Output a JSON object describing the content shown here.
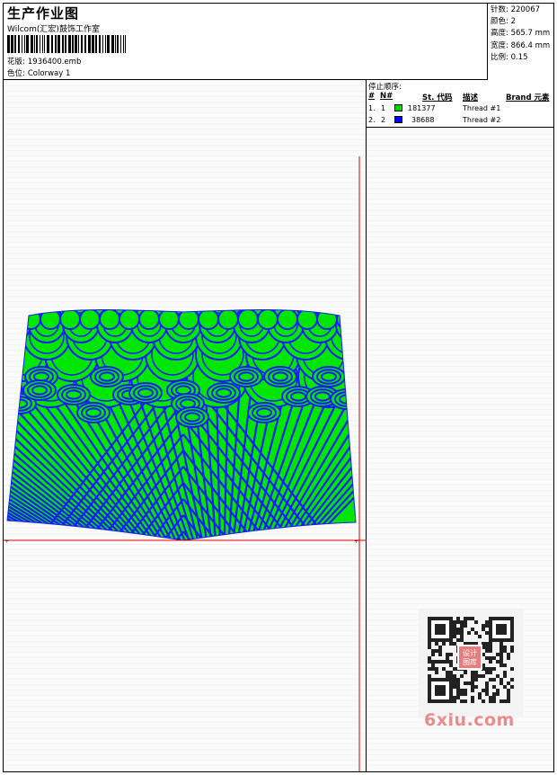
{
  "header": {
    "title": "生产作业图",
    "company": "Wilcom(汇宏)鼓饰工作室",
    "design_label": "花版:",
    "design_value": "1936400.emb",
    "color_label": "色位:",
    "color_value": "Colorway 1"
  },
  "specs": [
    {
      "label": "针数:",
      "value": "220067"
    },
    {
      "label": "颜色:",
      "value": "2"
    },
    {
      "label": "高度:",
      "value": "565.7 mm"
    },
    {
      "label": "宽度:",
      "value": "866.4 mm"
    },
    {
      "label": "比例:",
      "value": "0.15"
    }
  ],
  "stop_sequence": {
    "title": "停止顺序:",
    "headers": {
      "num": "#",
      "needle": "N#",
      "st_code": "St. 代码",
      "desc": "描述",
      "brand": "Brand 元素"
    },
    "rows": [
      {
        "num": "1.",
        "needle": "1",
        "swatch": "#00d800",
        "code": "181377",
        "desc": "Thread #1"
      },
      {
        "num": "2.",
        "needle": "2",
        "swatch": "#0000e8",
        "code": "38688",
        "desc": "Thread #2"
      }
    ]
  },
  "design_colors": {
    "fill": "#00e600",
    "outline": "#1a1aff",
    "guide": "#d40000"
  },
  "watermark": {
    "text": "6xiu.com",
    "qr_label": "设计图库"
  }
}
